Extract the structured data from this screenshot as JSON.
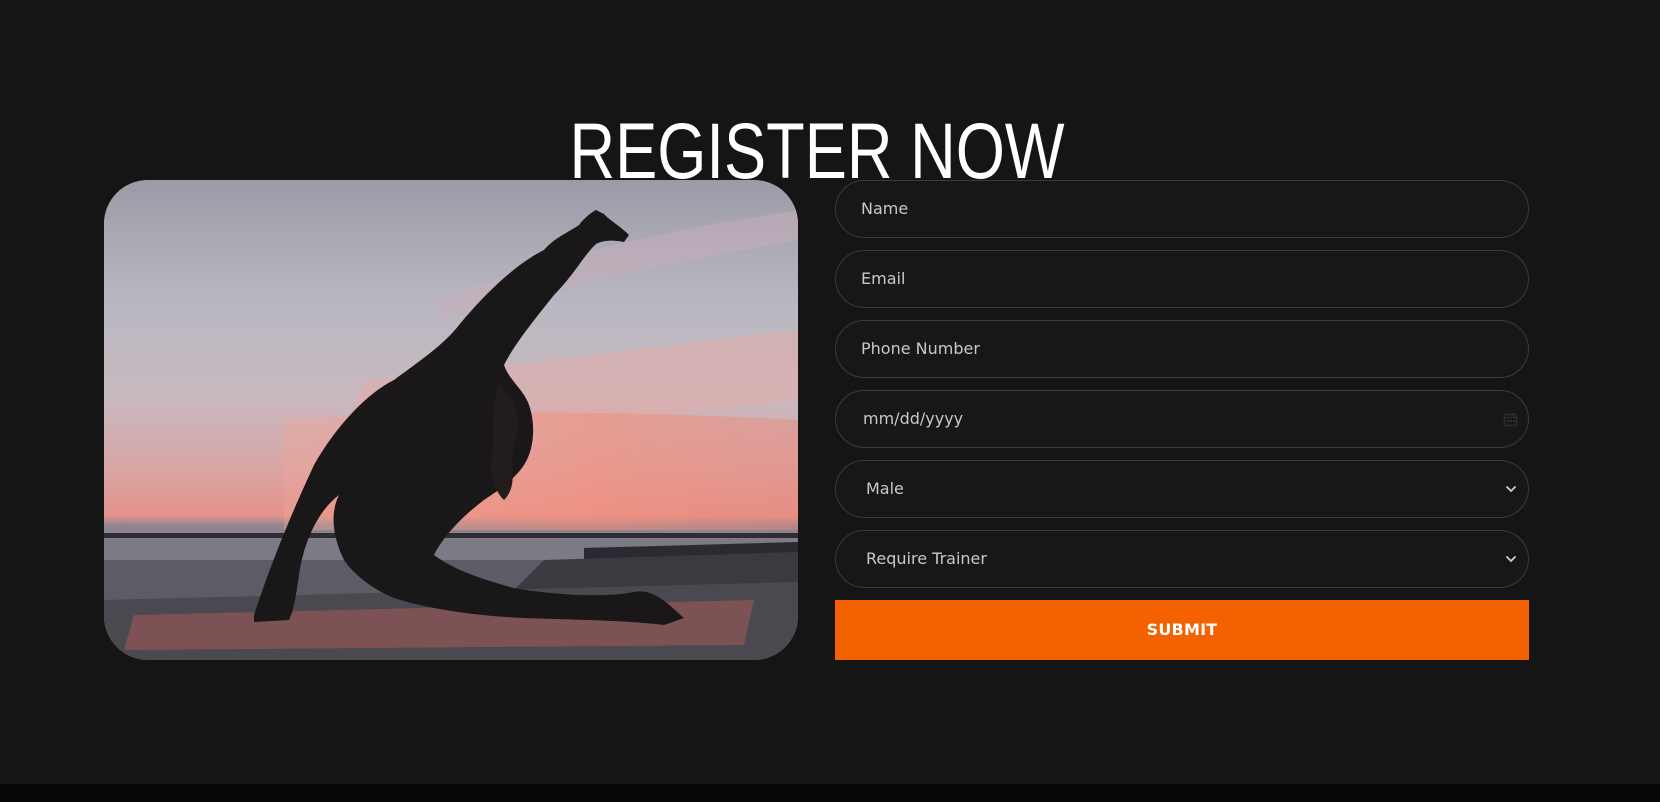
{
  "section": {
    "title": "REGISTER NOW"
  },
  "form": {
    "name_placeholder": "Name",
    "email_placeholder": "Email",
    "phone_placeholder": "Phone Number",
    "date_placeholder": "mm/dd/yyyy",
    "gender_selected": "Male",
    "trainer_selected": "Require Trainer",
    "submit_label": "SUBMIT"
  },
  "icons": {
    "date": "calendar-icon",
    "select": "chevron-down-icon"
  },
  "colors": {
    "background": "#151516",
    "accent": "#f36100",
    "field_border": "#3b3b3d",
    "text": "#c9c9cb"
  }
}
